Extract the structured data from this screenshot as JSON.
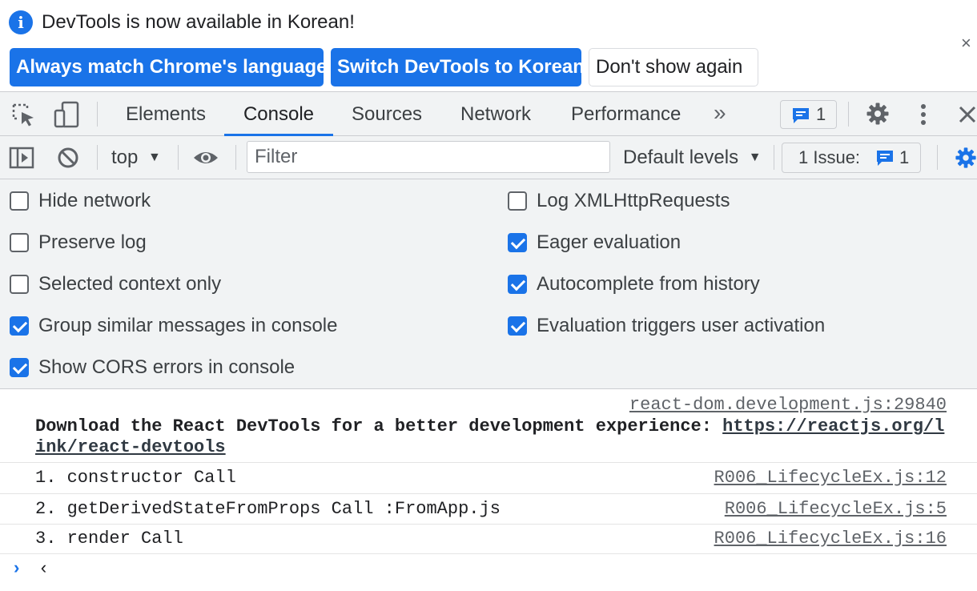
{
  "infobar": {
    "message": "DevTools is now available in Korean!",
    "buttons": {
      "match_language": "Always match Chrome's language",
      "switch_korean": "Switch DevTools to Korean",
      "dont_show": "Don't show again"
    },
    "close_icon": "×"
  },
  "tabs": {
    "items": [
      "Elements",
      "Console",
      "Sources",
      "Network",
      "Performance"
    ],
    "active": "Console",
    "more_icon": "»",
    "issues_count": "1"
  },
  "toolbar": {
    "context": "top",
    "filter_placeholder": "Filter",
    "levels": "Default levels",
    "issues_label": "1 Issue:",
    "issues_count": "1"
  },
  "settings": {
    "left": [
      {
        "label": "Hide network",
        "checked": false
      },
      {
        "label": "Preserve log",
        "checked": false
      },
      {
        "label": "Selected context only",
        "checked": false
      },
      {
        "label": "Group similar messages in console",
        "checked": true
      },
      {
        "label": "Show CORS errors in console",
        "checked": true
      }
    ],
    "right": [
      {
        "label": "Log XMLHttpRequests",
        "checked": false
      },
      {
        "label": "Eager evaluation",
        "checked": true
      },
      {
        "label": "Autocomplete from history",
        "checked": true
      },
      {
        "label": "Evaluation triggers user activation",
        "checked": true
      }
    ]
  },
  "console": {
    "react_source": "react-dom.development.js:29840",
    "react_msg": "Download the React DevTools for a better development experience: ",
    "react_link_1": "https://reactjs.org/l",
    "react_link_2": "ink/react-devtools",
    "messages": [
      {
        "text": "1. constructor Call",
        "source": "R006_LifecycleEx.js:12"
      },
      {
        "text": "2. getDerivedStateFromProps Call :FromApp.js",
        "source": "R006_LifecycleEx.js:5"
      },
      {
        "text": "3. render Call",
        "source": "R006_LifecycleEx.js:16"
      }
    ],
    "prompt_symbol": "›",
    "prompt_cursor": "‹"
  },
  "colors": {
    "accent": "#1a73e8",
    "panel_bg": "#f1f3f4"
  }
}
